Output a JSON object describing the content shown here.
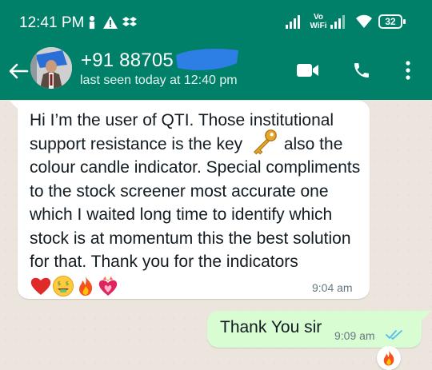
{
  "status_bar": {
    "time": "12:41 PM",
    "wifi_label": "Vo WiFi",
    "battery": "32"
  },
  "header": {
    "contact_name": "+91 88705",
    "last_seen": "last seen today at 12:40 pm"
  },
  "messages": [
    {
      "direction": "incoming",
      "text": "Hi I’m the user of QTI. Those institutional support resistance is the key",
      "text_after_key": " also the colour candle indicator. Special compliments to the stock screener most accurate one which I waited long time to identify which stock is at momentum this the best solution for that. Thank you for the indicators",
      "time": "9:04 am"
    },
    {
      "direction": "outgoing",
      "text": "Thank You sir",
      "time": "9:09 am",
      "status": "read",
      "reaction": "fire"
    }
  ],
  "colors": {
    "header": "#008069",
    "chat_bg": "#ece5dd",
    "incoming_bubble": "#ffffff",
    "outgoing_bubble": "#d9fdd3",
    "read_ticks": "#53bdeb"
  }
}
